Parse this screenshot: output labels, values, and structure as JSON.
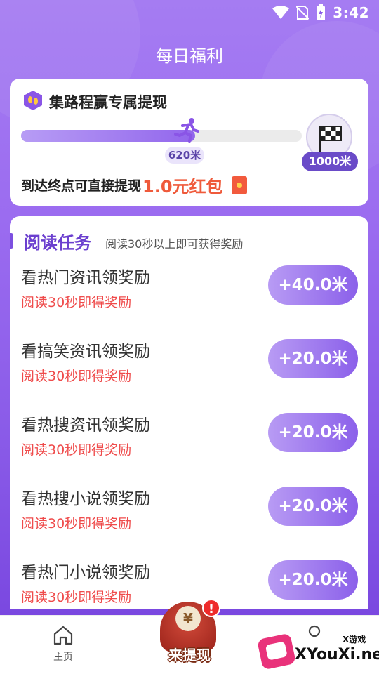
{
  "status_bar": {
    "time": "3:42",
    "icons": [
      "wifi-icon",
      "no-sim-icon",
      "battery-charging-icon"
    ]
  },
  "page_title": "每日福利",
  "withdraw_card": {
    "title": "集路程赢专属提现",
    "progress_label": "620米",
    "progress_value_m": 620,
    "goal_label": "1000米",
    "goal_value_m": 1000,
    "reward_prefix": "到达终点可直接提现",
    "reward_amount": "1.0元红包",
    "icons": [
      "footprint-badge-icon",
      "runner-icon",
      "checkered-flag-icon",
      "red-packet-icon"
    ]
  },
  "reading_tasks": {
    "title": "阅读任务",
    "subtitle": "阅读30秒以上即可获得奖励",
    "items": [
      {
        "name": "看热门资讯领奖励",
        "hint": "阅读30秒即得奖励",
        "reward": "+40.0米"
      },
      {
        "name": "看搞笑资讯领奖励",
        "hint": "阅读30秒即得奖励",
        "reward": "+20.0米"
      },
      {
        "name": "看热搜资讯领奖励",
        "hint": "阅读30秒即得奖励",
        "reward": "+20.0米"
      },
      {
        "name": "看热搜小说领奖励",
        "hint": "阅读30秒即得奖励",
        "reward": "+20.0米"
      },
      {
        "name": "看热门小说领奖励",
        "hint": "阅读30秒即得奖励",
        "reward": "+20.0米"
      }
    ]
  },
  "bottom_nav": {
    "home_label": "主页",
    "center_label": "来提现",
    "center_badge": "!",
    "coin_symbol": "¥"
  },
  "watermark": {
    "small": "X游戏",
    "big": "XYouXi.net"
  },
  "colors": {
    "accent": "#8b60ea",
    "title_purple": "#6b3fcf",
    "reward_red": "#ef5a3b",
    "hint_red": "#ef4b4b"
  }
}
